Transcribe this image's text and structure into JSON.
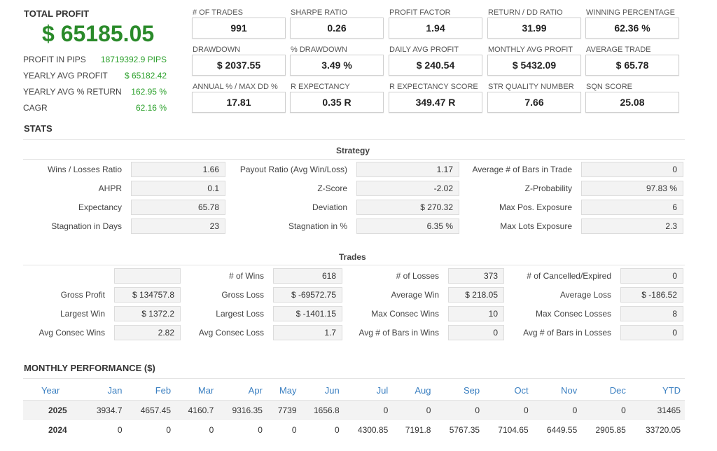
{
  "summary": {
    "total_profit_label": "TOTAL PROFIT",
    "total_profit_value": "$ 65185.05",
    "rows": [
      {
        "label": "PROFIT IN PIPS",
        "value": "18719392.9 PIPS"
      },
      {
        "label": "YEARLY AVG PROFIT",
        "value": "$ 65182.42"
      },
      {
        "label": "YEARLY AVG % RETURN",
        "value": "162.95 %"
      },
      {
        "label": "CAGR",
        "value": "62.16 %"
      }
    ]
  },
  "kpis": [
    {
      "label": "# OF TRADES",
      "value": "991"
    },
    {
      "label": "SHARPE RATIO",
      "value": "0.26"
    },
    {
      "label": "PROFIT FACTOR",
      "value": "1.94"
    },
    {
      "label": "RETURN / DD RATIO",
      "value": "31.99"
    },
    {
      "label": "WINNING PERCENTAGE",
      "value": "62.36 %"
    },
    {
      "label": "DRAWDOWN",
      "value": "$ 2037.55"
    },
    {
      "label": "% DRAWDOWN",
      "value": "3.49 %"
    },
    {
      "label": "DAILY AVG PROFIT",
      "value": "$ 240.54"
    },
    {
      "label": "MONTHLY AVG PROFIT",
      "value": "$ 5432.09"
    },
    {
      "label": "AVERAGE TRADE",
      "value": "$ 65.78"
    },
    {
      "label": "ANNUAL % / MAX DD %",
      "value": "17.81"
    },
    {
      "label": "R EXPECTANCY",
      "value": "0.35 R"
    },
    {
      "label": "R EXPECTANCY SCORE",
      "value": "349.47 R"
    },
    {
      "label": "STR QUALITY NUMBER",
      "value": "7.66"
    },
    {
      "label": "SQN SCORE",
      "value": "25.08"
    }
  ],
  "stats_title": "STATS",
  "strategy": {
    "title": "Strategy",
    "cells": [
      {
        "label": "Wins / Losses Ratio",
        "value": "1.66"
      },
      {
        "label": "Payout Ratio (Avg Win/Loss)",
        "value": "1.17"
      },
      {
        "label": "Average # of Bars in Trade",
        "value": "0"
      },
      {
        "label": "AHPR",
        "value": "0.1"
      },
      {
        "label": "Z-Score",
        "value": "-2.02"
      },
      {
        "label": "Z-Probability",
        "value": "97.83 %"
      },
      {
        "label": "Expectancy",
        "value": "65.78"
      },
      {
        "label": "Deviation",
        "value": "$ 270.32"
      },
      {
        "label": "Max Pos. Exposure",
        "value": "6"
      },
      {
        "label": "Stagnation in Days",
        "value": "23"
      },
      {
        "label": "Stagnation in %",
        "value": "6.35 %"
      },
      {
        "label": "Max Lots Exposure",
        "value": "2.3"
      }
    ]
  },
  "trades": {
    "title": "Trades",
    "cells": [
      {
        "label": "",
        "value": ""
      },
      {
        "label": "# of Wins",
        "value": "618"
      },
      {
        "label": "# of Losses",
        "value": "373"
      },
      {
        "label": "# of Cancelled/Expired",
        "value": "0"
      },
      {
        "label": "Gross Profit",
        "value": "$ 134757.8"
      },
      {
        "label": "Gross Loss",
        "value": "$ -69572.75"
      },
      {
        "label": "Average Win",
        "value": "$ 218.05"
      },
      {
        "label": "Average Loss",
        "value": "$ -186.52"
      },
      {
        "label": "Largest Win",
        "value": "$ 1372.2"
      },
      {
        "label": "Largest Loss",
        "value": "$ -1401.15"
      },
      {
        "label": "Max Consec Wins",
        "value": "10"
      },
      {
        "label": "Max Consec Losses",
        "value": "8"
      },
      {
        "label": "Avg Consec Wins",
        "value": "2.82"
      },
      {
        "label": "Avg Consec Loss",
        "value": "1.7"
      },
      {
        "label": "Avg # of Bars in Wins",
        "value": "0"
      },
      {
        "label": "Avg # of Bars in Losses",
        "value": "0"
      }
    ]
  },
  "monthly": {
    "title": "MONTHLY PERFORMANCE ($)",
    "headers": [
      "Year",
      "Jan",
      "Feb",
      "Mar",
      "Apr",
      "May",
      "Jun",
      "Jul",
      "Aug",
      "Sep",
      "Oct",
      "Nov",
      "Dec",
      "YTD"
    ],
    "rows": [
      [
        "2025",
        "3934.7",
        "4657.45",
        "4160.7",
        "9316.35",
        "7739",
        "1656.8",
        "0",
        "0",
        "0",
        "0",
        "0",
        "0",
        "31465"
      ],
      [
        "2024",
        "0",
        "0",
        "0",
        "0",
        "0",
        "0",
        "4300.85",
        "7191.8",
        "5767.35",
        "7104.65",
        "6449.55",
        "2905.85",
        "33720.05"
      ]
    ]
  }
}
